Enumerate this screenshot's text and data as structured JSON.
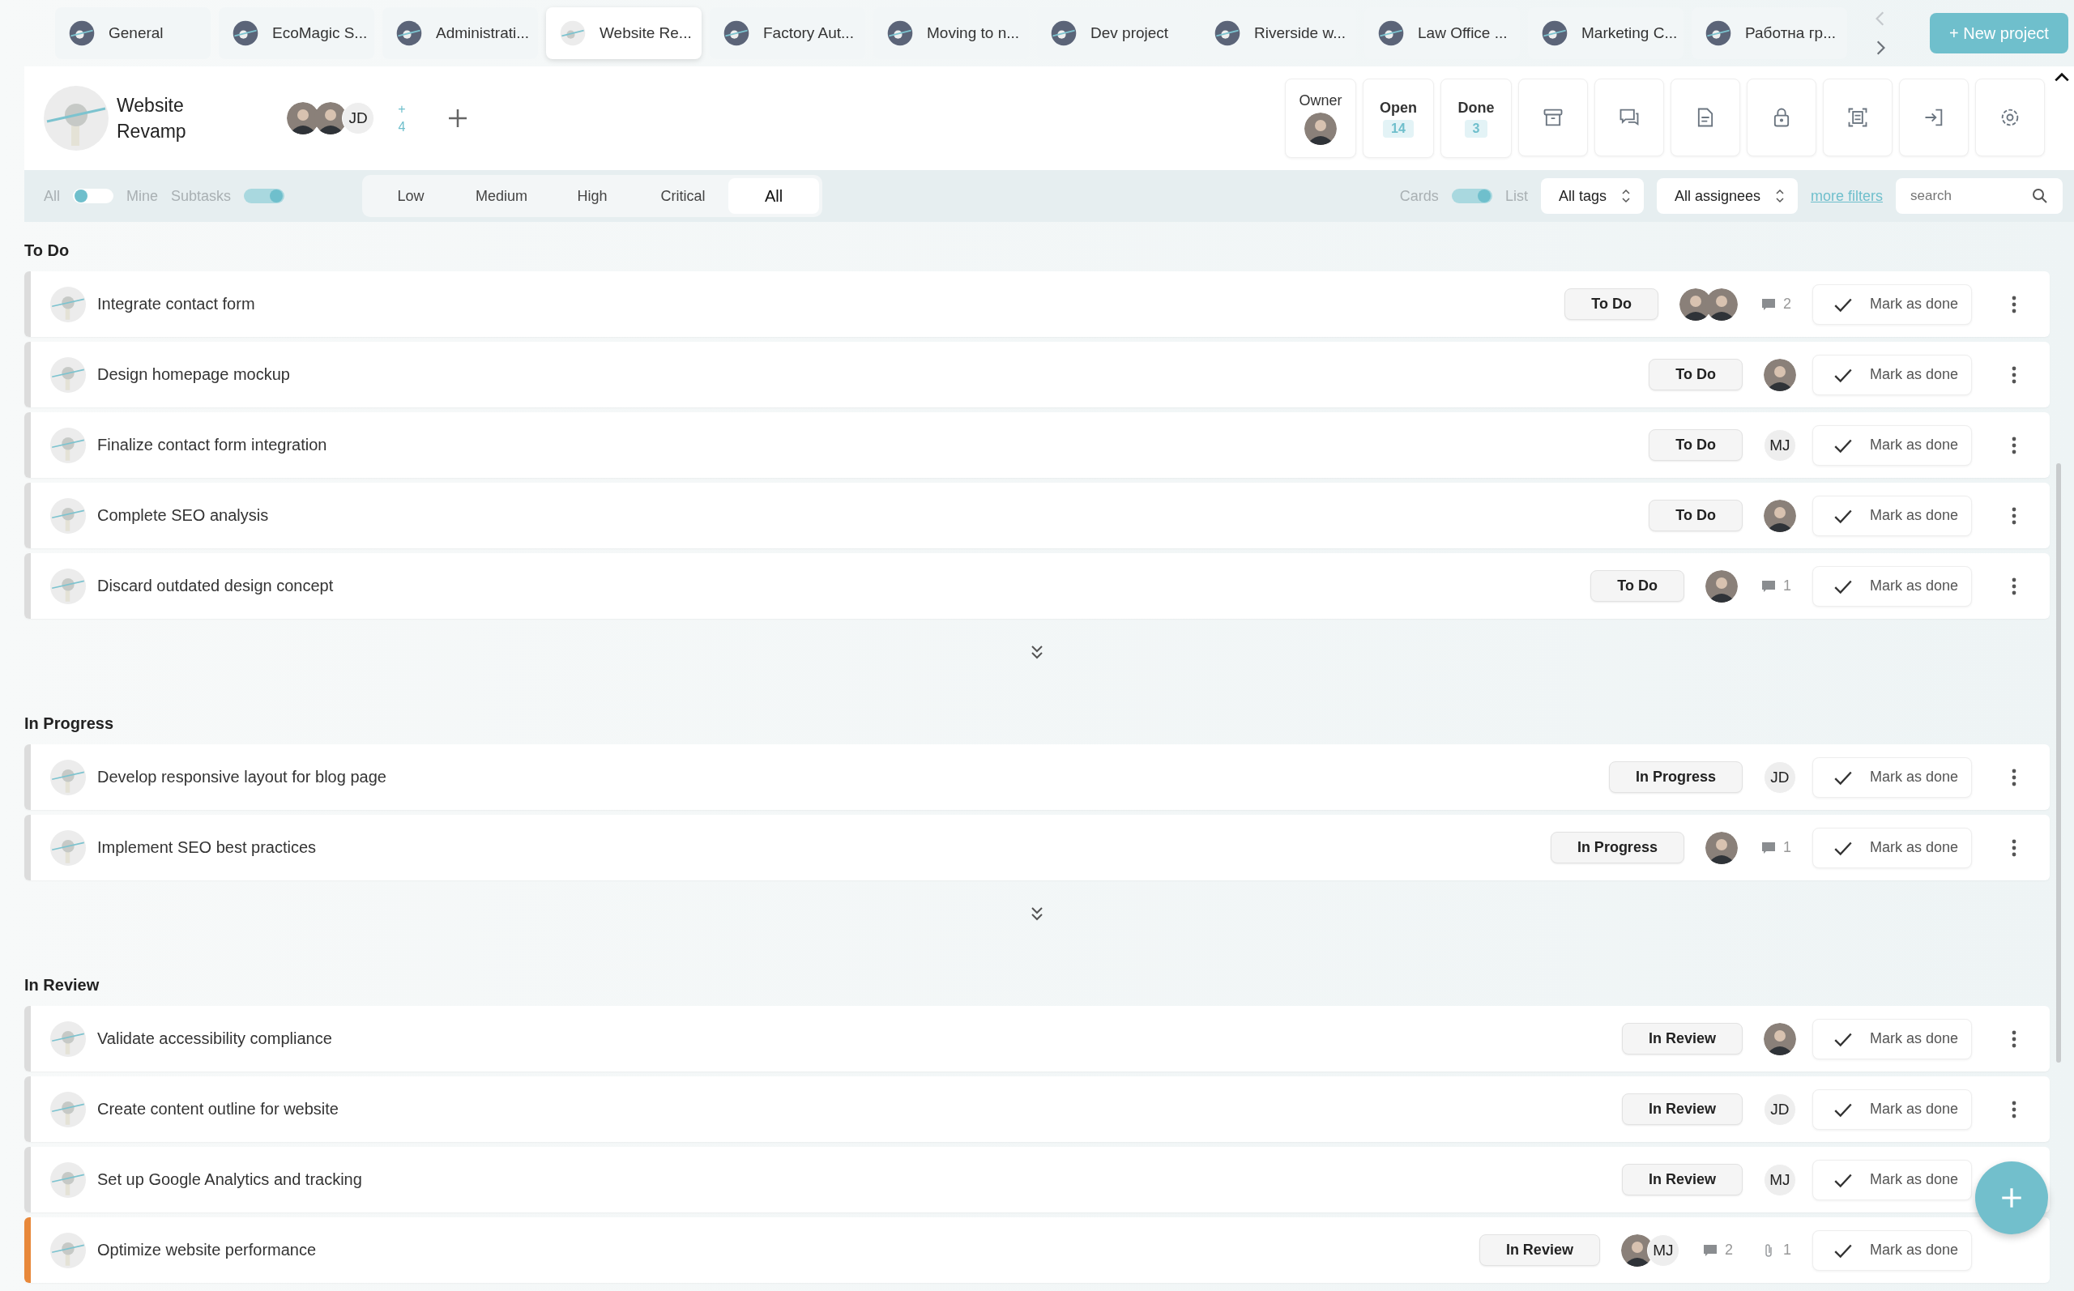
{
  "tabs": [
    {
      "label": "General",
      "selected": false
    },
    {
      "label": "EcoMagic S...",
      "selected": false
    },
    {
      "label": "Administrati...",
      "selected": false
    },
    {
      "label": "Website Re...",
      "selected": true
    },
    {
      "label": "Factory Aut...",
      "selected": false
    },
    {
      "label": "Moving to n...",
      "selected": false
    },
    {
      "label": "Dev project",
      "selected": false
    },
    {
      "label": "Riverside w...",
      "selected": false
    },
    {
      "label": "Law Office ...",
      "selected": false
    },
    {
      "label": "Marketing C...",
      "selected": false
    },
    {
      "label": "Работна гр...",
      "selected": false
    }
  ],
  "new_project_button": "+ New project",
  "project": {
    "title": "Website Revamp",
    "members": [
      {
        "kind": "photo"
      },
      {
        "kind": "photo"
      },
      {
        "kind": "initials",
        "initials": "JD"
      }
    ],
    "more_members": "+ 4"
  },
  "stats": [
    {
      "kind": "owner",
      "label": "Owner"
    },
    {
      "kind": "count",
      "label": "Open",
      "value": "14"
    },
    {
      "kind": "count",
      "label": "Done",
      "value": "3"
    }
  ],
  "filters": {
    "all_label": "All",
    "mine_label": "Mine",
    "mine": false,
    "subtasks_label": "Subtasks",
    "subtasks": true,
    "priorities": [
      {
        "label": "Low",
        "selected": false
      },
      {
        "label": "Medium",
        "selected": false
      },
      {
        "label": "High",
        "selected": false
      },
      {
        "label": "Critical",
        "selected": false
      },
      {
        "label": "All",
        "selected": true
      }
    ],
    "cards_label": "Cards",
    "list_label": "List",
    "list": true,
    "tags": "All tags",
    "assignees": "All assignees",
    "more_filters": "more filters",
    "search_placeholder": "search"
  },
  "sections": [
    {
      "title": "To Do",
      "collapsed_more": true,
      "tasks": [
        {
          "title": "Integrate contact form",
          "status": "To Do",
          "color": "#dcdcdc",
          "assignees": [
            {
              "kind": "photo"
            },
            {
              "kind": "photo"
            }
          ],
          "comments": "2",
          "done_label": "Mark as done"
        },
        {
          "title": "Design homepage mockup",
          "status": "To Do",
          "color": "#dcdcdc",
          "assignees": [
            {
              "kind": "photo"
            }
          ],
          "done_label": "Mark as done"
        },
        {
          "title": "Finalize contact form integration",
          "status": "To Do",
          "color": "#dcdcdc",
          "assignees": [
            {
              "kind": "initials",
              "initials": "MJ"
            }
          ],
          "done_label": "Mark as done"
        },
        {
          "title": "Complete SEO analysis",
          "status": "To Do",
          "color": "#dcdcdc",
          "assignees": [
            {
              "kind": "photo"
            }
          ],
          "done_label": "Mark as done"
        },
        {
          "title": "Discard outdated design concept",
          "status": "To Do",
          "color": "#dcdcdc",
          "assignees": [
            {
              "kind": "photo"
            }
          ],
          "comments": "1",
          "done_label": "Mark as done"
        }
      ]
    },
    {
      "title": "In Progress",
      "collapsed_more": true,
      "tasks": [
        {
          "title": "Develop responsive layout for blog page",
          "status": "In Progress",
          "color": "#dcdcdc",
          "assignees": [
            {
              "kind": "initials",
              "initials": "JD"
            }
          ],
          "done_label": "Mark as done"
        },
        {
          "title": "Implement SEO best practices",
          "status": "In Progress",
          "color": "#dcdcdc",
          "assignees": [
            {
              "kind": "photo"
            }
          ],
          "comments": "1",
          "done_label": "Mark as done"
        }
      ]
    },
    {
      "title": "In Review",
      "collapsed_more": false,
      "tasks": [
        {
          "title": "Validate accessibility compliance",
          "status": "In Review",
          "color": "#dcdcdc",
          "assignees": [
            {
              "kind": "photo"
            }
          ],
          "done_label": "Mark as done"
        },
        {
          "title": "Create content outline for website",
          "status": "In Review",
          "color": "#dcdcdc",
          "assignees": [
            {
              "kind": "initials",
              "initials": "JD"
            }
          ],
          "done_label": "Mark as done"
        },
        {
          "title": "Set up Google Analytics and tracking",
          "status": "In Review",
          "color": "#dcdcdc",
          "assignees": [
            {
              "kind": "initials",
              "initials": "MJ"
            }
          ],
          "done_label": "Mark as done"
        },
        {
          "title": "Optimize website performance",
          "status": "In Review",
          "color": "#e8883a",
          "assignees": [
            {
              "kind": "photo"
            },
            {
              "kind": "initials",
              "initials": "MJ"
            }
          ],
          "comments": "2",
          "attachments": "1",
          "done_label": "Mark as done"
        }
      ]
    }
  ]
}
